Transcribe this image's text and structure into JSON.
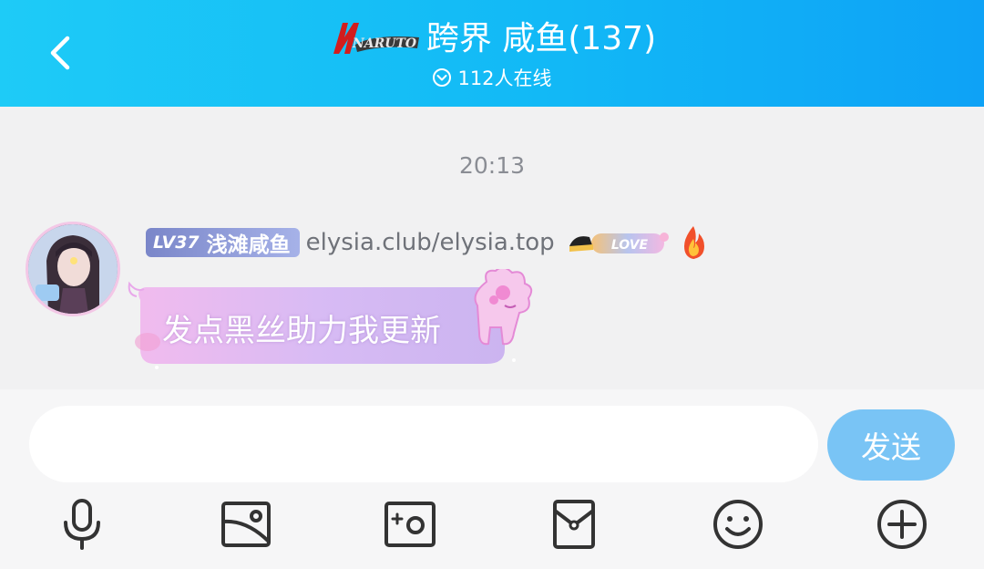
{
  "header": {
    "logo_text": "NARUTO",
    "title": "跨界 咸鱼(137)",
    "online": "112人在线"
  },
  "chat": {
    "timestamp": "20:13",
    "message": {
      "level": "LV37",
      "group_nickname": "浅滩咸鱼",
      "nickname": "elysia.club/elysia.top",
      "badge_text": "LOVE",
      "text": "发点黑丝助力我更新"
    }
  },
  "input": {
    "value": "",
    "placeholder": "",
    "send_label": "发送"
  },
  "toolbar": {
    "icons": [
      "microphone-icon",
      "image-icon",
      "camera-icon",
      "red-packet-icon",
      "emoji-icon",
      "plus-icon"
    ]
  },
  "colors": {
    "header_start": "#1ecbf7",
    "header_end": "#0ea2f6",
    "send_button": "#79c4f5",
    "level_badge": "#8e9ad8",
    "bubble_accent": "#d9b7f3"
  }
}
